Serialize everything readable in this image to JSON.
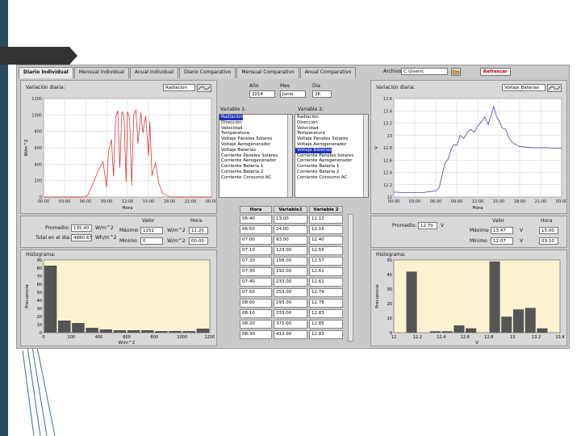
{
  "tabs": [
    {
      "label": "Diario Individual",
      "active": true
    },
    {
      "label": "Mensual Individual"
    },
    {
      "label": "Anual Individual"
    },
    {
      "label": "Diario Comparativo"
    },
    {
      "label": "Mensual Comparativo"
    },
    {
      "label": "Anual Comparativo"
    }
  ],
  "toolbar": {
    "archivo_label": "Archivo:",
    "archivo_value": "C:\\Users\\",
    "refresh_label": "Refrescar"
  },
  "left": {
    "title": "Variación diaria:",
    "variable": "Radiacion",
    "chart_data": {
      "type": "line",
      "x_ticks": [
        "00:00",
        "03:00",
        "06:00",
        "09:00",
        "12:00",
        "15:00",
        "18:00",
        "21:00",
        "00:00"
      ],
      "y_ticks": [
        "0",
        "200",
        "400",
        "600",
        "800",
        "1000",
        "1200"
      ],
      "ylim": [
        0,
        1200
      ],
      "xlabel": "Hora",
      "ylabel": "W/m^2",
      "series_color": "#d22020",
      "series": [
        {
          "values": [
            [
              0,
              0
            ],
            [
              5.9,
              0
            ],
            [
              6.3,
              20
            ],
            [
              7,
              150
            ],
            [
              7.8,
              320
            ],
            [
              8.5,
              430
            ],
            [
              9,
              120
            ],
            [
              9.3,
              560
            ],
            [
              9.7,
              700
            ],
            [
              10,
              250
            ],
            [
              10.3,
              980
            ],
            [
              10.6,
              1050
            ],
            [
              10.9,
              360
            ],
            [
              11.2,
              1040
            ],
            [
              11.5,
              980
            ],
            [
              11.8,
              180
            ],
            [
              12,
              1040
            ],
            [
              12.3,
              960
            ],
            [
              12.6,
              140
            ],
            [
              12.9,
              1000
            ],
            [
              13.2,
              1060
            ],
            [
              13.5,
              650
            ],
            [
              13.9,
              1030
            ],
            [
              14.2,
              780
            ],
            [
              14.6,
              990
            ],
            [
              15,
              500
            ],
            [
              15.2,
              920
            ],
            [
              15.5,
              260
            ],
            [
              16,
              420
            ],
            [
              16.5,
              160
            ],
            [
              17,
              50
            ],
            [
              17.6,
              20
            ],
            [
              18,
              0
            ],
            [
              24,
              0
            ]
          ]
        }
      ]
    },
    "stats": {
      "valor_label": "Valor",
      "hora_label": "Hora",
      "promedio_label": "Promedio:",
      "promedio": "135.40",
      "promedio_unit": "W/m^2",
      "total_label": "Total en el dia:",
      "total": "4880.67",
      "total_unit": "Wh/m^2",
      "max_label": "Máximo",
      "max": "1152",
      "max_unit": "W/m^2",
      "max_hora": "11:20",
      "min_label": "Mínimo",
      "min": "0",
      "min_unit": "W/m^2",
      "min_hora": "00:00"
    },
    "hist": {
      "title": "Histograma:",
      "chart_data": {
        "type": "bar",
        "bin_starts": [
          0,
          100,
          200,
          300,
          400,
          500,
          600,
          700,
          800,
          900,
          1000,
          1100
        ],
        "values": [
          83,
          15,
          12,
          6,
          4,
          3,
          3,
          3,
          2,
          2,
          2,
          5
        ],
        "ylim": [
          0,
          90
        ],
        "y_ticks": [
          "0",
          "10",
          "20",
          "30",
          "40",
          "50",
          "60",
          "70",
          "80",
          "90"
        ],
        "x_ticks": [
          "0",
          "200",
          "400",
          "600",
          "800",
          "1000",
          "1200"
        ],
        "xlabel": "W/m^2",
        "ylabel": "Frecuencia",
        "bar_color": "#555555",
        "bg": "#fbf3d0"
      }
    }
  },
  "center": {
    "ano_label": "Año",
    "ano": "2014",
    "mes_label": "Mes",
    "mes": "Junio",
    "dia_label": "Día",
    "dia": "26",
    "var1_label": "Variable 1:",
    "var2_label": "Variable 2:",
    "variables": [
      "Radiacion",
      "Dirección",
      "Velocidad",
      "Temperatura",
      "Voltaje Paneles Solares",
      "Voltaje Aerogenerador",
      "Voltaje Baterías",
      "Corriente Paneles Solares",
      "Corriente Aerogenerador",
      "Corriente Batería 1",
      "Corriente Batería 2",
      "Corriente Consumo AC"
    ],
    "var1_selected": 0,
    "var2_selected": 6,
    "table": {
      "headers": [
        "Hora",
        "Variable1",
        "Variable 2"
      ],
      "rows": [
        [
          "06:40",
          "13.00",
          "12.12"
        ],
        [
          "06:50",
          "24.00",
          "12.16"
        ],
        [
          "07:00",
          "93.00",
          "12.40"
        ],
        [
          "07:10",
          "123.00",
          "12.55"
        ],
        [
          "07:20",
          "158.00",
          "12.57"
        ],
        [
          "07:30",
          "192.00",
          "12.61"
        ],
        [
          "07:40",
          "233.00",
          "12.61"
        ],
        [
          "07:50",
          "253.00",
          "12.74"
        ],
        [
          "08:00",
          "293.00",
          "12.78"
        ],
        [
          "08:10",
          "333.00",
          "12.83"
        ],
        [
          "08:20",
          "371.00",
          "12.85"
        ],
        [
          "08:30",
          "413.00",
          "12.83"
        ]
      ]
    }
  },
  "right": {
    "title": "Variación diaria:",
    "variable": "Voltaje Baterias",
    "chart_data": {
      "type": "line",
      "x_ticks": [
        "00:00",
        "03:00",
        "06:00",
        "09:00",
        "12:00",
        "15:00",
        "18:00",
        "21:00",
        "00:00"
      ],
      "y_ticks": [
        "12",
        "12.2",
        "12.4",
        "12.6",
        "12.8",
        "13",
        "13.2",
        "13.4",
        "13.6"
      ],
      "ylim": [
        12,
        13.6
      ],
      "xlabel": "Hora",
      "ylabel": "V",
      "series_color": "#2a2aa0",
      "series": [
        {
          "values": [
            [
              0,
              12.08
            ],
            [
              2,
              12.07
            ],
            [
              4,
              12.07
            ],
            [
              6,
              12.1
            ],
            [
              6.5,
              12.15
            ],
            [
              7,
              12.4
            ],
            [
              7.3,
              12.55
            ],
            [
              7.8,
              12.62
            ],
            [
              8.2,
              12.78
            ],
            [
              8.6,
              12.85
            ],
            [
              9,
              12.84
            ],
            [
              9.5,
              13.0
            ],
            [
              10,
              12.95
            ],
            [
              10.5,
              13.05
            ],
            [
              11,
              13.1
            ],
            [
              11.5,
              13.05
            ],
            [
              12,
              13.15
            ],
            [
              12.5,
              13.22
            ],
            [
              13,
              13.3
            ],
            [
              13.5,
              13.18
            ],
            [
              14,
              13.36
            ],
            [
              14.3,
              13.47
            ],
            [
              14.7,
              13.3
            ],
            [
              15,
              13.25
            ],
            [
              15.5,
              13.12
            ],
            [
              16,
              13.1
            ],
            [
              16.5,
              12.95
            ],
            [
              17,
              12.88
            ],
            [
              18,
              12.82
            ],
            [
              20,
              12.8
            ],
            [
              22,
              12.8
            ],
            [
              24,
              12.79
            ]
          ]
        }
      ]
    },
    "stats": {
      "valor_label": "Valor",
      "hora_label": "Hora",
      "promedio_label": "Promedio:",
      "promedio": "12.70",
      "promedio_unit": "V",
      "max_label": "Máximo",
      "max": "13.47",
      "max_unit": "V",
      "max_hora": "15:00",
      "min_label": "Mínimo",
      "min": "12.07",
      "min_unit": "V",
      "min_hora": "03:10"
    },
    "hist": {
      "title": "Histograma:",
      "chart_data": {
        "type": "bar",
        "bin_starts": [
          12,
          12.1,
          12.2,
          12.3,
          12.4,
          12.5,
          12.6,
          12.7,
          12.8,
          12.9,
          13,
          13.1,
          13.2,
          13.3,
          13.4
        ],
        "values": [
          0,
          42,
          0,
          1,
          1,
          5,
          3,
          0,
          49,
          11,
          16,
          17,
          3
        ],
        "ylim": [
          0,
          50
        ],
        "y_ticks": [
          "0",
          "10",
          "20",
          "30",
          "40",
          "50"
        ],
        "x_ticks": [
          "12",
          "12.2",
          "12.4",
          "12.6",
          "12.8",
          "13",
          "13.2",
          "13.4"
        ],
        "xlabel": "V",
        "ylabel": "Frecuencia",
        "bar_color": "#555555",
        "bg": "#fbf3d0"
      }
    }
  }
}
